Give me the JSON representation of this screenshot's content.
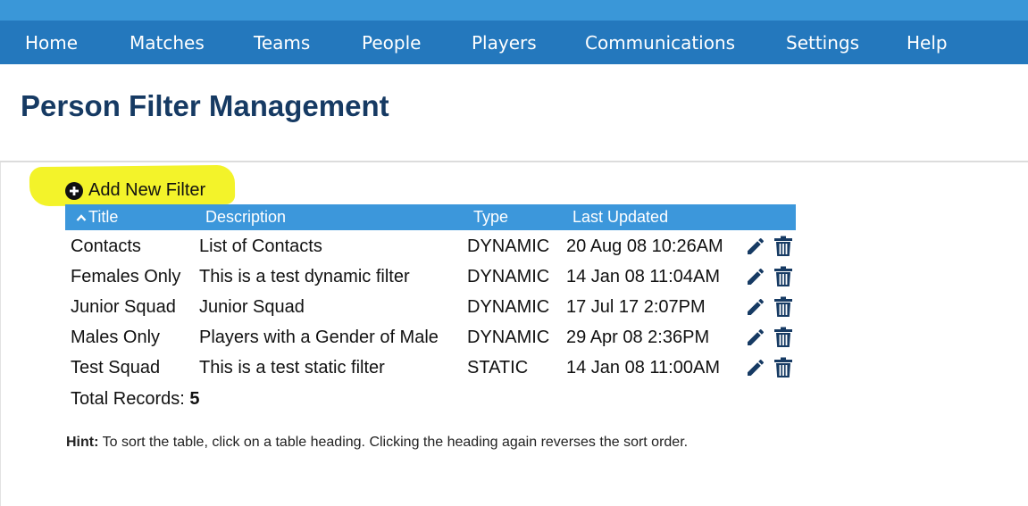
{
  "nav": {
    "items": [
      "Home",
      "Matches",
      "Teams",
      "People",
      "Players",
      "Communications",
      "Settings",
      "Help"
    ]
  },
  "page": {
    "title": "Person Filter Management",
    "add_label": "Add New Filter"
  },
  "table": {
    "headers": {
      "title": "Title",
      "description": "Description",
      "type": "Type",
      "last_updated": "Last Updated"
    },
    "sort": {
      "column": "Title",
      "direction": "ascending"
    },
    "rows": [
      {
        "title": "Contacts",
        "description": "List of Contacts",
        "type": "DYNAMIC",
        "last_updated": "20 Aug 08 10:26AM"
      },
      {
        "title": "Females Only",
        "description": "This is a test dynamic filter",
        "type": "DYNAMIC",
        "last_updated": "14 Jan 08 11:04AM"
      },
      {
        "title": "Junior Squad",
        "description": "Junior Squad",
        "type": "DYNAMIC",
        "last_updated": "17 Jul 17 2:07PM"
      },
      {
        "title": "Males Only",
        "description": "Players with a Gender of Male",
        "type": "DYNAMIC",
        "last_updated": "29 Apr 08 2:36PM"
      },
      {
        "title": "Test Squad",
        "description": "This is a test static filter",
        "type": "STATIC",
        "last_updated": "14 Jan 08 11:00AM"
      }
    ],
    "row_actions": [
      "pencil-icon",
      "trash-icon"
    ],
    "total_label": "Total Records:",
    "total_count": "5"
  },
  "hint": {
    "label": "Hint:",
    "text": "To sort the table, click on a table heading. Clicking the heading again reverses the sort order."
  },
  "colors": {
    "nav_bar": "#2478bd",
    "top_strip": "#3a97d8",
    "table_header": "#3c97db",
    "title": "#163a63",
    "icon": "#163a63",
    "highlight": "#f3f32a"
  }
}
